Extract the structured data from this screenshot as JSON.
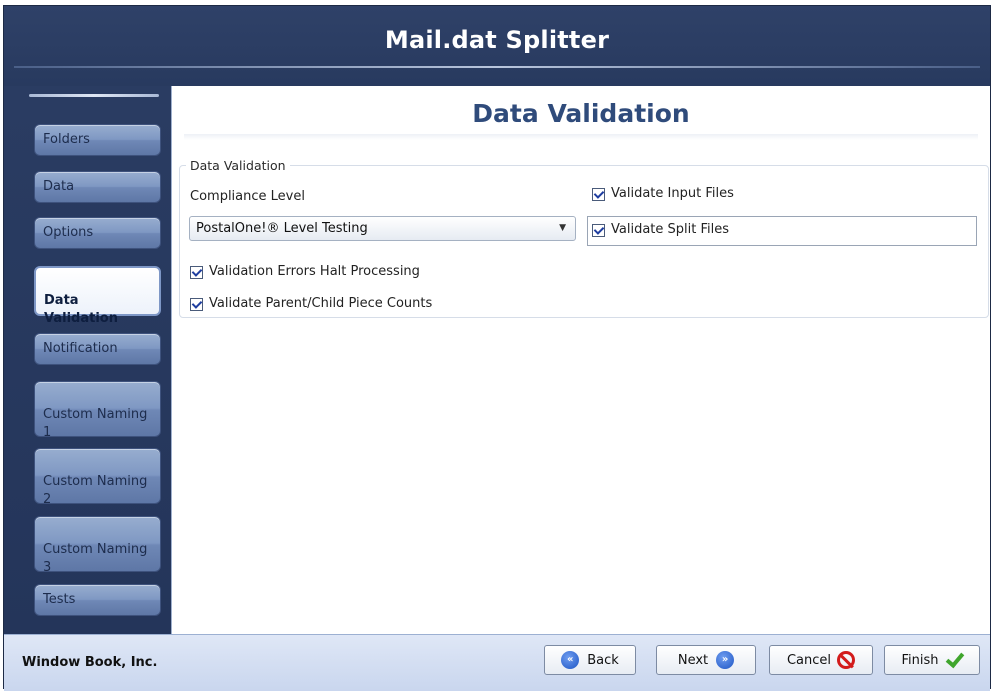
{
  "window": {
    "title": "Mail.dat Splitter"
  },
  "sidebar": {
    "items": [
      {
        "label": "Folders",
        "active": false
      },
      {
        "label": "Data",
        "active": false
      },
      {
        "label": "Options",
        "active": false
      },
      {
        "label": "Data\nValidation",
        "active": true
      },
      {
        "label": "Notification",
        "active": false
      },
      {
        "label": "Custom Naming\n1",
        "active": false
      },
      {
        "label": "Custom Naming\n2",
        "active": false
      },
      {
        "label": "Custom Naming\n3",
        "active": false
      },
      {
        "label": "Tests",
        "active": false
      }
    ]
  },
  "main": {
    "page_title": "Data Validation",
    "group_title": "Data Validation",
    "compliance_label": "Compliance Level",
    "compliance_value": "PostalOne!® Level Testing",
    "checkboxes": {
      "validate_input_files": {
        "label": "Validate Input Files",
        "checked": true
      },
      "validate_split_files": {
        "label": "Validate Split Files",
        "checked": true
      },
      "errors_halt": {
        "label": "Validation Errors Halt Processing",
        "checked": true
      },
      "parent_child_counts": {
        "label": "Validate Parent/Child Piece Counts",
        "checked": true
      }
    }
  },
  "footer": {
    "company": "Window Book, Inc.",
    "back_label": "Back",
    "next_label": "Next",
    "cancel_label": "Cancel",
    "finish_label": "Finish"
  },
  "colors": {
    "frame": "#2c3e63",
    "accent_title": "#2f4b7b",
    "cancel_red": "#d31c1c",
    "finish_green": "#3fa52d",
    "nav_blue": "#1d55c4"
  }
}
